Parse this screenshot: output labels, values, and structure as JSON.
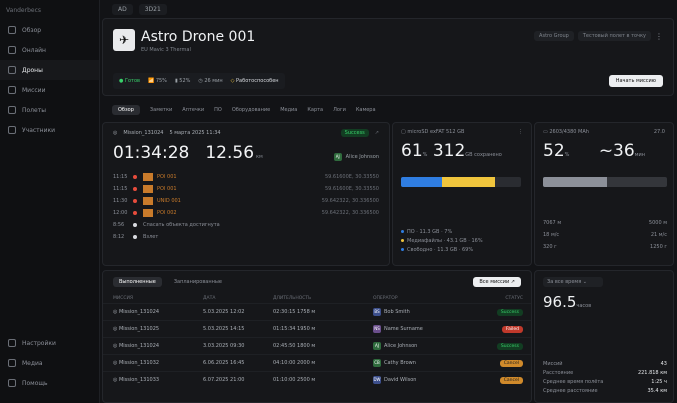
{
  "sidebar": {
    "brand": "Vanderbecs",
    "items": [
      {
        "label": "Обзор",
        "icon": "grid-icon"
      },
      {
        "label": "Онлайн",
        "icon": "monitor-icon"
      },
      {
        "label": "Дроны",
        "icon": "drone-icon",
        "active": true
      },
      {
        "label": "Миссии",
        "icon": "eye-icon"
      },
      {
        "label": "Полеты",
        "icon": "book-icon"
      },
      {
        "label": "Участники",
        "icon": "users-icon"
      }
    ],
    "bottom": [
      {
        "label": "Настройки",
        "icon": "gear-icon"
      },
      {
        "label": "Медиа",
        "icon": "image-icon"
      },
      {
        "label": "Помощь",
        "icon": "help-icon"
      }
    ]
  },
  "topbar": {
    "badge": "AD",
    "label": "3D21"
  },
  "drone": {
    "title": "Astro Drone 001",
    "subtitle": "EU Mavic 3 Thermal",
    "group_pill": "Astro Group",
    "test_pill": "Тестовый полет в точку",
    "status": {
      "state": "Готов",
      "signal": "75%",
      "battery": "52%",
      "time": "26 мин",
      "ready": "Работоспособен"
    },
    "start_button": "Начать миссию"
  },
  "tabs": [
    "Обзор",
    "Заметки",
    "Аптечки",
    "ПО",
    "Оборудование",
    "Медиа",
    "Карта",
    "Логи",
    "Камера"
  ],
  "mission": {
    "name": "Mission_131024",
    "date": "5 марта 2025 11:34",
    "status": "Success",
    "timer": "01:34:28",
    "distance": "12.56",
    "distance_unit": "км",
    "user_initials": "AJ",
    "user": "Alice Johnson",
    "events": [
      {
        "time": "11:15",
        "label": "POI 001",
        "coords": "59.61600E, 30.33550",
        "thumb": true
      },
      {
        "time": "11:15",
        "label": "POI 001",
        "coords": "59.61600E, 30.33550",
        "thumb": true
      },
      {
        "time": "11:30",
        "label": "UNID 001",
        "coords": "59.642322, 30.336500",
        "thumb": true
      },
      {
        "time": "12:00",
        "label": "POI 002",
        "coords": "59.642322, 30.336500",
        "thumb": true
      },
      {
        "time": "8:56",
        "label": "Спасать объекта достигнута",
        "coords": "",
        "thumb": false
      },
      {
        "time": "8:12",
        "label": "Взлет",
        "coords": "",
        "thumb": false
      }
    ]
  },
  "storage": {
    "title": "microSD exFAT 512 GB",
    "used": "61",
    "used_unit": "%",
    "total": "312",
    "total_unit": "GB сохранено",
    "bar": {
      "po": 0.34,
      "media": 0.44
    },
    "legend": [
      {
        "label": "ПО · 11.3 GB · 7%",
        "color": "#2f7de1"
      },
      {
        "label": "Медиафайлы · 43.1 GB · 16%",
        "color": "#f0c53d"
      },
      {
        "label": "Свободно · 11.3 GB · 69%",
        "color": "#2f7de1"
      }
    ]
  },
  "battery": {
    "title": "2603/4380 MAh",
    "temp": "27.0",
    "percent": "52",
    "percent_unit": "%",
    "minutes": "~36",
    "minutes_unit": "мин",
    "fill": 0.52,
    "metrics": [
      {
        "label": "7067 м",
        "value": "5000 м"
      },
      {
        "label": "18 м/с",
        "value": "21 м/с"
      },
      {
        "label": "320 г",
        "value": "1250 г"
      }
    ]
  },
  "missions_list": {
    "tab_done": "Выполненные",
    "tab_sched": "Запланированные",
    "all_button": "Все миссии",
    "columns": [
      "МИССИЯ",
      "ДАТА",
      "ДЛИТЕЛЬНОСТЬ",
      "ОПЕРАТОР",
      "СТАТУС"
    ],
    "rows": [
      {
        "name": "Mission_131024",
        "date": "5.03.2025 12:02",
        "dur": "02:30:15 1758 м",
        "op": "Bob Smith",
        "initials": "BS",
        "avc": "#3c4f8c",
        "status": "Success",
        "sc": "#39d16b",
        "sbg": "#123d22"
      },
      {
        "name": "Mission_131025",
        "date": "5.03.2025 14:15",
        "dur": "01:15:34 1950 м",
        "op": "Name Surname",
        "initials": "NS",
        "avc": "#6b4f8c",
        "status": "Failed",
        "sc": "#ffffff",
        "sbg": "#c0392b"
      },
      {
        "name": "Mission_131024",
        "date": "3.03.2025 09:30",
        "dur": "02:45:50 1800 м",
        "op": "Alice Johnson",
        "initials": "AJ",
        "avc": "#2f6b3d",
        "status": "Success",
        "sc": "#39d16b",
        "sbg": "#123d22"
      },
      {
        "name": "Mission_131032",
        "date": "6.06.2025 16:45",
        "dur": "04:10:00 2000 м",
        "op": "Cathy Brown",
        "initials": "CB",
        "avc": "#2f6b3d",
        "status": "Cancel",
        "sc": "#1b1b1b",
        "sbg": "#d08a2b"
      },
      {
        "name": "Mission_131033",
        "date": "6.07.2025 21:00",
        "dur": "01:10:00 2500 м",
        "op": "David Wilson",
        "initials": "DW",
        "avc": "#3c4f8c",
        "status": "Cancel",
        "sc": "#1b1b1b",
        "sbg": "#d08a2b"
      }
    ]
  },
  "stats": {
    "period": "За все время",
    "hours": "96.5",
    "hours_unit": "часов",
    "rows": [
      {
        "label": "Миссий",
        "value": "43"
      },
      {
        "label": "Расстояние",
        "value": "221.818 км"
      },
      {
        "label": "Среднее время полёта",
        "value": "1:25 ч"
      },
      {
        "label": "Среднее расстояние",
        "value": "35.4 км"
      }
    ]
  }
}
